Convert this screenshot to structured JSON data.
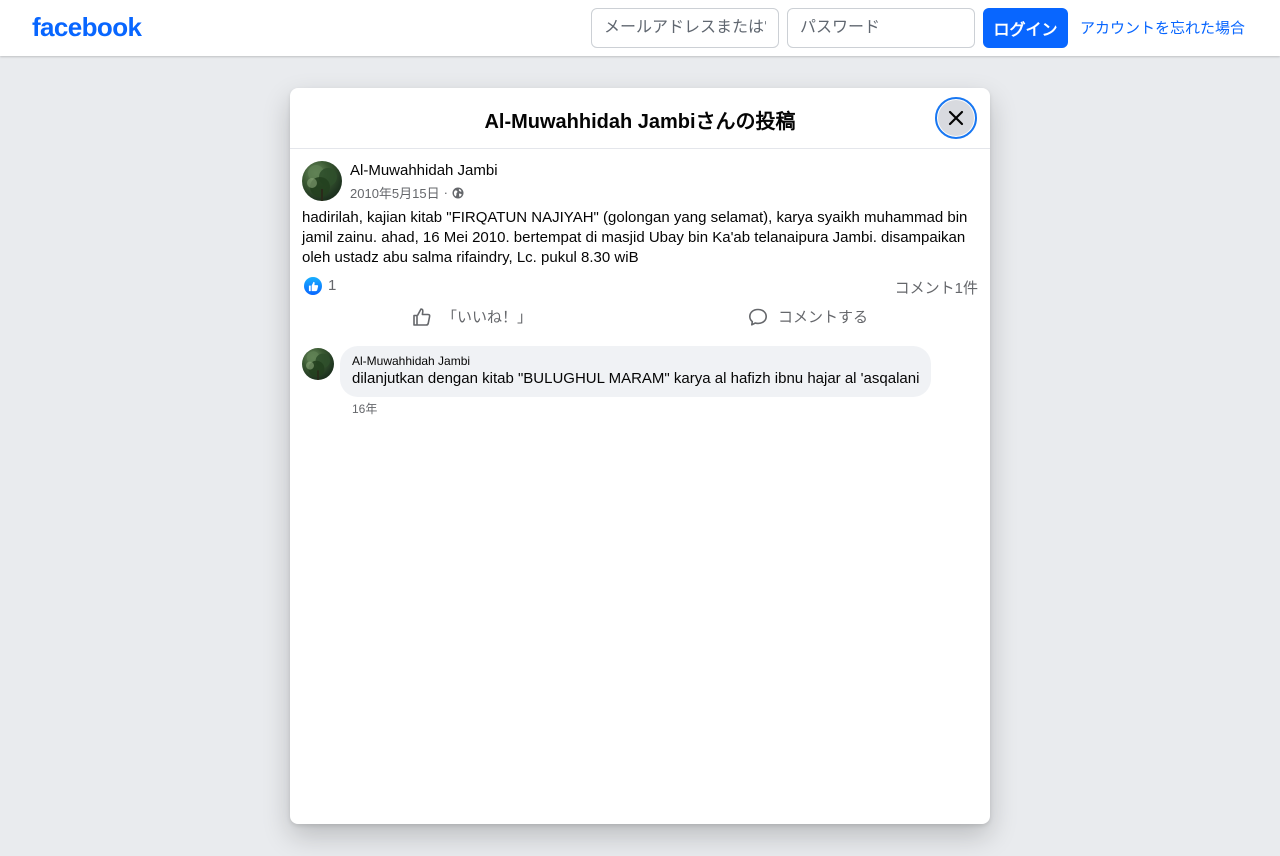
{
  "header": {
    "logo": "facebook",
    "email_placeholder": "メールアドレスまたは電話番号",
    "password_placeholder": "パスワード",
    "login_label": "ログイン",
    "forgot_label": "アカウントを忘れた場合"
  },
  "dialog": {
    "title": "Al-Muwahhidah Jambiさんの投稿",
    "close_icon": "close-icon"
  },
  "post": {
    "author": "Al-Muwahhidah Jambi",
    "date": "2010年5月15日",
    "separator": "·",
    "privacy_icon": "globe-icon",
    "text": "hadirilah, kajian kitab \"FIRQATUN NAJIYAH\" (golongan yang selamat), karya syaikh muhammad bin jamil zainu. ahad, 16 Mei 2010. bertempat di masjid Ubay bin Ka'ab telanaipura Jambi. disampaikan oleh ustadz abu salma rifaindry, Lc. pukul 8.30 wiB",
    "reaction_count": "1",
    "comment_count": "コメント1件",
    "like_label": "「いいね！」",
    "comment_label": "コメントする"
  },
  "comments": [
    {
      "author": "Al-Muwahhidah Jambi",
      "text": "dilanjutkan dengan kitab \"BULUGHUL MARAM\" karya al hafizh ibnu hajar al 'asqalani",
      "time": "16年"
    }
  ],
  "colors": {
    "brand": "#0866ff",
    "page_bg": "#e9ebee",
    "bubble_bg": "#f0f2f5",
    "secondary_text": "#65676b"
  }
}
